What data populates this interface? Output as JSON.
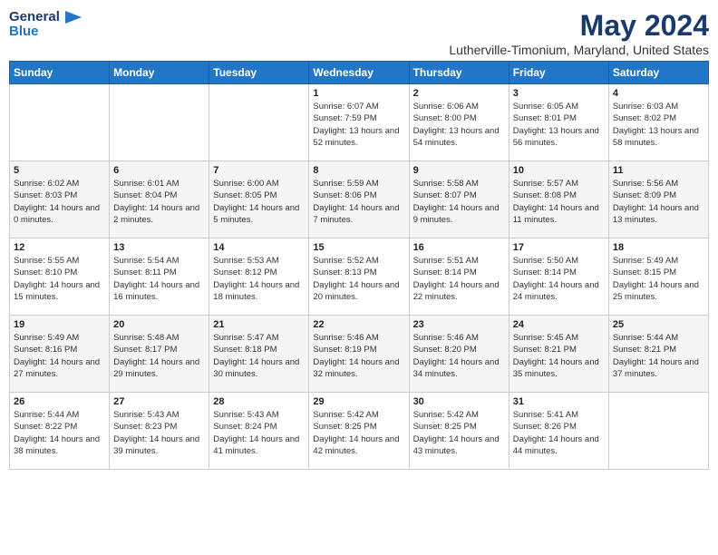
{
  "logo": {
    "line1": "General",
    "line2": "Blue"
  },
  "title": "May 2024",
  "location": "Lutherville-Timonium, Maryland, United States",
  "days_header": [
    "Sunday",
    "Monday",
    "Tuesday",
    "Wednesday",
    "Thursday",
    "Friday",
    "Saturday"
  ],
  "weeks": [
    [
      {
        "day": "",
        "sunrise": "",
        "sunset": "",
        "daylight": ""
      },
      {
        "day": "",
        "sunrise": "",
        "sunset": "",
        "daylight": ""
      },
      {
        "day": "",
        "sunrise": "",
        "sunset": "",
        "daylight": ""
      },
      {
        "day": "1",
        "sunrise": "Sunrise: 6:07 AM",
        "sunset": "Sunset: 7:59 PM",
        "daylight": "Daylight: 13 hours and 52 minutes."
      },
      {
        "day": "2",
        "sunrise": "Sunrise: 6:06 AM",
        "sunset": "Sunset: 8:00 PM",
        "daylight": "Daylight: 13 hours and 54 minutes."
      },
      {
        "day": "3",
        "sunrise": "Sunrise: 6:05 AM",
        "sunset": "Sunset: 8:01 PM",
        "daylight": "Daylight: 13 hours and 56 minutes."
      },
      {
        "day": "4",
        "sunrise": "Sunrise: 6:03 AM",
        "sunset": "Sunset: 8:02 PM",
        "daylight": "Daylight: 13 hours and 58 minutes."
      }
    ],
    [
      {
        "day": "5",
        "sunrise": "Sunrise: 6:02 AM",
        "sunset": "Sunset: 8:03 PM",
        "daylight": "Daylight: 14 hours and 0 minutes."
      },
      {
        "day": "6",
        "sunrise": "Sunrise: 6:01 AM",
        "sunset": "Sunset: 8:04 PM",
        "daylight": "Daylight: 14 hours and 2 minutes."
      },
      {
        "day": "7",
        "sunrise": "Sunrise: 6:00 AM",
        "sunset": "Sunset: 8:05 PM",
        "daylight": "Daylight: 14 hours and 5 minutes."
      },
      {
        "day": "8",
        "sunrise": "Sunrise: 5:59 AM",
        "sunset": "Sunset: 8:06 PM",
        "daylight": "Daylight: 14 hours and 7 minutes."
      },
      {
        "day": "9",
        "sunrise": "Sunrise: 5:58 AM",
        "sunset": "Sunset: 8:07 PM",
        "daylight": "Daylight: 14 hours and 9 minutes."
      },
      {
        "day": "10",
        "sunrise": "Sunrise: 5:57 AM",
        "sunset": "Sunset: 8:08 PM",
        "daylight": "Daylight: 14 hours and 11 minutes."
      },
      {
        "day": "11",
        "sunrise": "Sunrise: 5:56 AM",
        "sunset": "Sunset: 8:09 PM",
        "daylight": "Daylight: 14 hours and 13 minutes."
      }
    ],
    [
      {
        "day": "12",
        "sunrise": "Sunrise: 5:55 AM",
        "sunset": "Sunset: 8:10 PM",
        "daylight": "Daylight: 14 hours and 15 minutes."
      },
      {
        "day": "13",
        "sunrise": "Sunrise: 5:54 AM",
        "sunset": "Sunset: 8:11 PM",
        "daylight": "Daylight: 14 hours and 16 minutes."
      },
      {
        "day": "14",
        "sunrise": "Sunrise: 5:53 AM",
        "sunset": "Sunset: 8:12 PM",
        "daylight": "Daylight: 14 hours and 18 minutes."
      },
      {
        "day": "15",
        "sunrise": "Sunrise: 5:52 AM",
        "sunset": "Sunset: 8:13 PM",
        "daylight": "Daylight: 14 hours and 20 minutes."
      },
      {
        "day": "16",
        "sunrise": "Sunrise: 5:51 AM",
        "sunset": "Sunset: 8:14 PM",
        "daylight": "Daylight: 14 hours and 22 minutes."
      },
      {
        "day": "17",
        "sunrise": "Sunrise: 5:50 AM",
        "sunset": "Sunset: 8:14 PM",
        "daylight": "Daylight: 14 hours and 24 minutes."
      },
      {
        "day": "18",
        "sunrise": "Sunrise: 5:49 AM",
        "sunset": "Sunset: 8:15 PM",
        "daylight": "Daylight: 14 hours and 25 minutes."
      }
    ],
    [
      {
        "day": "19",
        "sunrise": "Sunrise: 5:49 AM",
        "sunset": "Sunset: 8:16 PM",
        "daylight": "Daylight: 14 hours and 27 minutes."
      },
      {
        "day": "20",
        "sunrise": "Sunrise: 5:48 AM",
        "sunset": "Sunset: 8:17 PM",
        "daylight": "Daylight: 14 hours and 29 minutes."
      },
      {
        "day": "21",
        "sunrise": "Sunrise: 5:47 AM",
        "sunset": "Sunset: 8:18 PM",
        "daylight": "Daylight: 14 hours and 30 minutes."
      },
      {
        "day": "22",
        "sunrise": "Sunrise: 5:46 AM",
        "sunset": "Sunset: 8:19 PM",
        "daylight": "Daylight: 14 hours and 32 minutes."
      },
      {
        "day": "23",
        "sunrise": "Sunrise: 5:46 AM",
        "sunset": "Sunset: 8:20 PM",
        "daylight": "Daylight: 14 hours and 34 minutes."
      },
      {
        "day": "24",
        "sunrise": "Sunrise: 5:45 AM",
        "sunset": "Sunset: 8:21 PM",
        "daylight": "Daylight: 14 hours and 35 minutes."
      },
      {
        "day": "25",
        "sunrise": "Sunrise: 5:44 AM",
        "sunset": "Sunset: 8:21 PM",
        "daylight": "Daylight: 14 hours and 37 minutes."
      }
    ],
    [
      {
        "day": "26",
        "sunrise": "Sunrise: 5:44 AM",
        "sunset": "Sunset: 8:22 PM",
        "daylight": "Daylight: 14 hours and 38 minutes."
      },
      {
        "day": "27",
        "sunrise": "Sunrise: 5:43 AM",
        "sunset": "Sunset: 8:23 PM",
        "daylight": "Daylight: 14 hours and 39 minutes."
      },
      {
        "day": "28",
        "sunrise": "Sunrise: 5:43 AM",
        "sunset": "Sunset: 8:24 PM",
        "daylight": "Daylight: 14 hours and 41 minutes."
      },
      {
        "day": "29",
        "sunrise": "Sunrise: 5:42 AM",
        "sunset": "Sunset: 8:25 PM",
        "daylight": "Daylight: 14 hours and 42 minutes."
      },
      {
        "day": "30",
        "sunrise": "Sunrise: 5:42 AM",
        "sunset": "Sunset: 8:25 PM",
        "daylight": "Daylight: 14 hours and 43 minutes."
      },
      {
        "day": "31",
        "sunrise": "Sunrise: 5:41 AM",
        "sunset": "Sunset: 8:26 PM",
        "daylight": "Daylight: 14 hours and 44 minutes."
      },
      {
        "day": "",
        "sunrise": "",
        "sunset": "",
        "daylight": ""
      }
    ]
  ]
}
